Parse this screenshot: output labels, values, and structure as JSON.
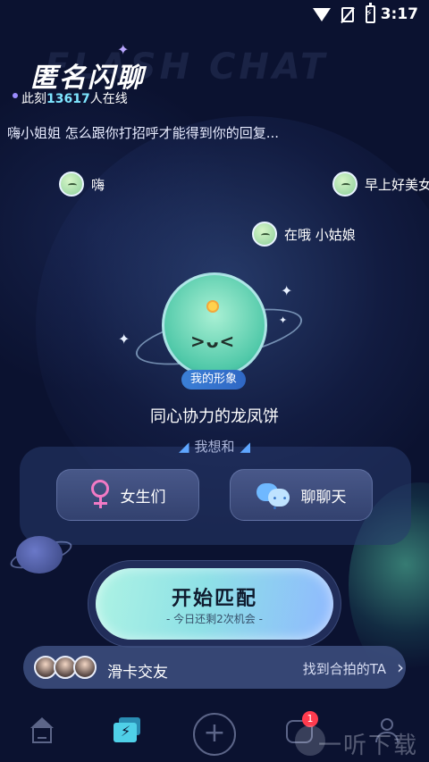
{
  "status_bar": {
    "time": "3:17"
  },
  "header": {
    "logo_text": "匿名闪聊",
    "watermark_text": "FLASH CHAT",
    "online_prefix": "此刻",
    "online_count": "13617",
    "online_suffix": "人在线"
  },
  "greeting": "嗨小姐姐 怎么跟你打招呼才能得到你的回复...",
  "bubbles": [
    {
      "text": "嗨"
    },
    {
      "text": "早上好美女"
    },
    {
      "text": "在哦 小姑娘"
    }
  ],
  "character": {
    "tag": "我的形象",
    "face": ">ᴗ<",
    "name": "同心协力的龙凤饼"
  },
  "want": {
    "label": "我想和",
    "options": [
      {
        "label": "女生们",
        "icon": "female-icon"
      },
      {
        "label": "聊聊天",
        "icon": "chat-bubbles-icon"
      }
    ]
  },
  "start": {
    "title": "开始匹配",
    "subtitle": "- 今日还剩2次机会 -"
  },
  "swipe": {
    "title": "滑卡交友",
    "link": "找到合拍的TA"
  },
  "tabbar": {
    "badge": "1",
    "watermark": "一听下载"
  }
}
